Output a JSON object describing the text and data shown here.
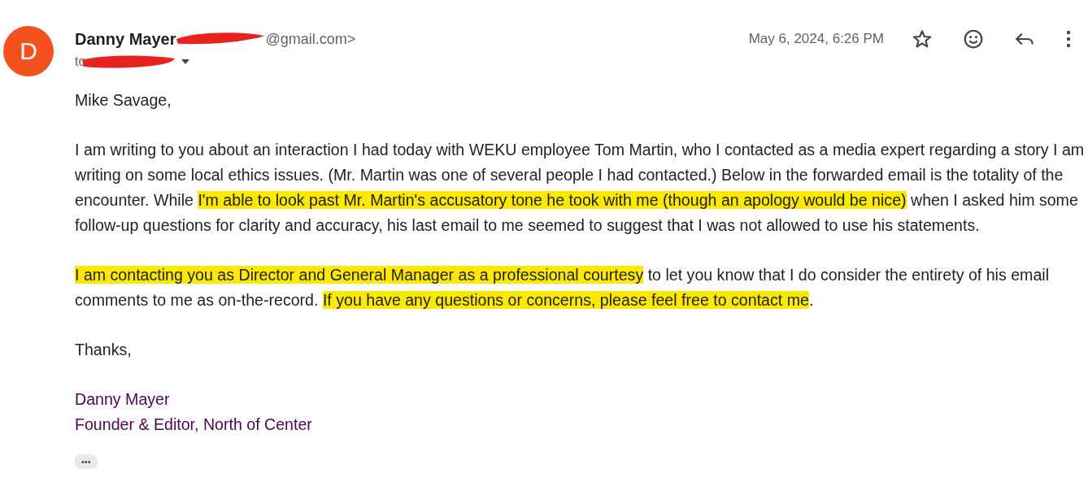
{
  "sender": {
    "avatar_letter": "D",
    "name": "Danny Mayer",
    "email_visible": "@gmail.com>",
    "email_redacted": true
  },
  "recipient": {
    "prefix": "to",
    "redacted": true
  },
  "date": "May 6, 2024, 6:26 PM",
  "greeting": "Mike Savage,",
  "paragraphs": [
    [
      {
        "text": "I am writing to you about an interaction I had today with WEKU employee Tom Martin, who I contacted as a media expert regarding a story I am writing on some local ethics issues. (Mr. Martin was one of several people I had contacted.) Below in the forwarded email is the totality of the encounter. While ",
        "highlighted": false
      },
      {
        "text": "I'm able to look past Mr. Martin's accusatory tone he took with me (though an apology would be nice)",
        "highlighted": true
      },
      {
        "text": " when I asked him some follow-up questions for clarity and accuracy, his last email to me seemed to suggest that I was not allowed to use his statements.",
        "highlighted": false
      }
    ],
    [
      {
        "text": "I am contacting you as Director and General Manager as a professional courtesy",
        "highlighted": true
      },
      {
        "text": " to let you know that I do consider the entirety of his email comments to me as on-the-record.  ",
        "highlighted": false
      },
      {
        "text": "If you have any questions or concerns, please feel free to contact me",
        "highlighted": true
      },
      {
        "text": ".",
        "highlighted": false
      }
    ]
  ],
  "closing": "Thanks,",
  "signature": [
    "Danny Mayer",
    "Founder & Editor, North of Center"
  ],
  "more_button": "•••"
}
